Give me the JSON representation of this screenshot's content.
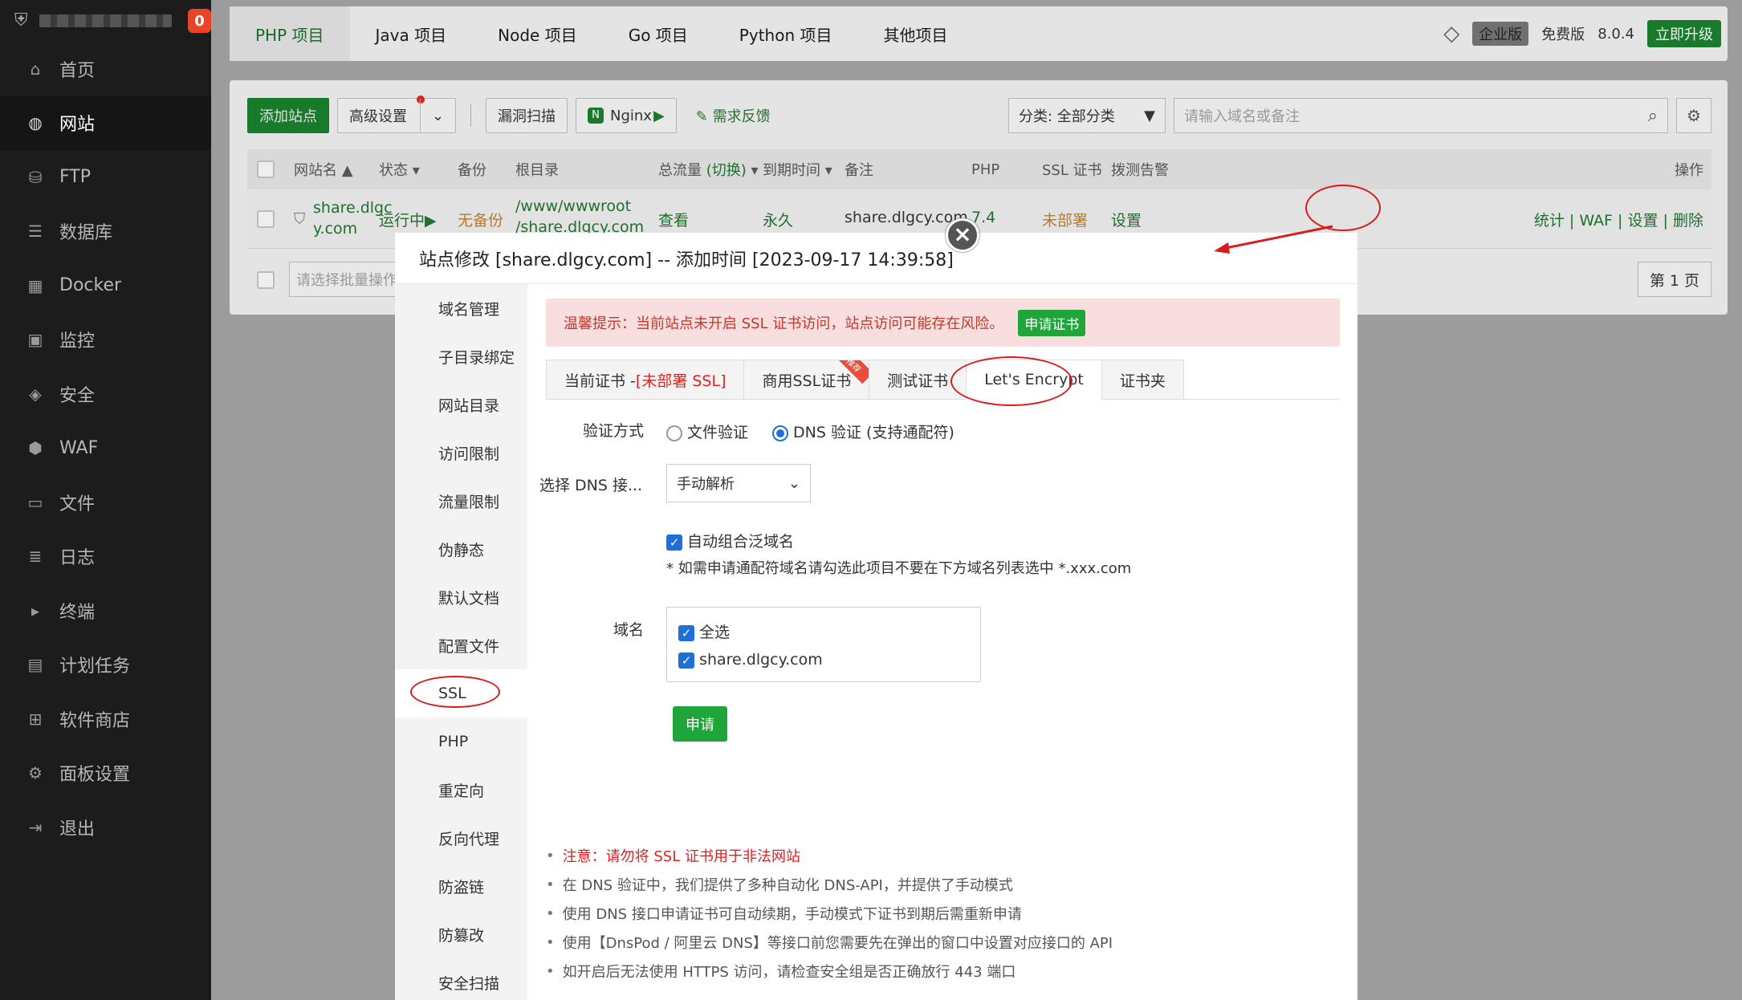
{
  "sidebar": {
    "badge": "0",
    "items": [
      {
        "label": "首页",
        "icon": "home-icon"
      },
      {
        "label": "网站",
        "icon": "globe-icon"
      },
      {
        "label": "FTP",
        "icon": "ftp-icon"
      },
      {
        "label": "数据库",
        "icon": "database-icon"
      },
      {
        "label": "Docker",
        "icon": "docker-icon"
      },
      {
        "label": "监控",
        "icon": "monitor-icon"
      },
      {
        "label": "安全",
        "icon": "shield-icon"
      },
      {
        "label": "WAF",
        "icon": "waf-icon"
      },
      {
        "label": "文件",
        "icon": "folder-icon"
      },
      {
        "label": "日志",
        "icon": "log-icon"
      },
      {
        "label": "终端",
        "icon": "terminal-icon"
      },
      {
        "label": "计划任务",
        "icon": "calendar-icon"
      },
      {
        "label": "软件商店",
        "icon": "apps-icon"
      },
      {
        "label": "面板设置",
        "icon": "settings-icon"
      },
      {
        "label": "退出",
        "icon": "logout-icon"
      }
    ]
  },
  "topbar": {
    "tabs": [
      "PHP 项目",
      "Java 项目",
      "Node 项目",
      "Go 项目",
      "Python 项目",
      "其他项目"
    ],
    "enterprise": "企业版",
    "free": "免费版",
    "version": "8.0.4",
    "upgrade": "立即升级"
  },
  "toolbar": {
    "add_site": "添加站点",
    "advanced": "高级设置",
    "vuln_scan": "漏洞扫描",
    "nginx": "Nginx",
    "feedback": "需求反馈",
    "category": "分类: 全部分类",
    "search_placeholder": "请输入域名或备注"
  },
  "table": {
    "headers": {
      "name": "网站名",
      "status": "状态",
      "backup": "备份",
      "root": "根目录",
      "traffic": "总流量",
      "switch": "(切换)",
      "expire": "到期时间",
      "remark": "备注",
      "php": "PHP",
      "ssl": "SSL 证书",
      "alert": "拨测告警",
      "ops": "操作"
    },
    "row": {
      "name_line1": "share.dlgc",
      "name_line2": "y.com",
      "status": "运行中",
      "backup": "无备份",
      "root_line1": "/www/wwwroot",
      "root_line2": "/share.dlgcy.com",
      "traffic": "查看",
      "expire": "永久",
      "remark": "share.dlgcy.com",
      "php": "7.4",
      "ssl": "未部署",
      "alert": "设置",
      "ops": [
        "统计",
        "WAF",
        "设置",
        "删除"
      ]
    },
    "batch_placeholder": "请选择批量操作",
    "page": "第 1 页"
  },
  "modal": {
    "title": "站点修改 [share.dlgcy.com] -- 添加时间 [2023-09-17 14:39:58]",
    "nav": [
      "域名管理",
      "子目录绑定",
      "网站目录",
      "访问限制",
      "流量限制",
      "伪静态",
      "默认文档",
      "配置文件",
      "SSL",
      "PHP",
      "重定向",
      "反向代理",
      "防盗链",
      "防篡改",
      "安全扫描"
    ],
    "alert_text": "温馨提示：当前站点未开启 SSL 证书访问，站点访问可能存在风险。",
    "alert_button": "申请证书",
    "tabs": {
      "current_prefix": "当前证书 - ",
      "current_status": "[未部署 SSL]",
      "commercial": "商用SSL证书",
      "ribbon": "推荐",
      "test": "测试证书",
      "letsencrypt": "Let's Encrypt",
      "folder": "证书夹"
    },
    "form": {
      "verify_label": "验证方式",
      "file_verify": "文件验证",
      "dns_verify": "DNS 验证 (支持通配符)",
      "dns_label": "选择 DNS 接...",
      "dns_value": "手动解析",
      "auto_wildcard": "自动组合泛域名",
      "wildcard_note": "* 如需申请通配符域名请勾选此项目不要在下方域名列表选中 *.xxx.com",
      "domain_label": "域名",
      "select_all": "全选",
      "domain1": "share.dlgcy.com",
      "submit": "申请"
    },
    "notes": [
      "注意：请勿将 SSL 证书用于非法网站",
      "在 DNS 验证中，我们提供了多种自动化 DNS-API，并提供了手动模式",
      "使用 DNS 接口申请证书可自动续期，手动模式下证书到期后需重新申请",
      "使用【DnsPod / 阿里云 DNS】等接口前您需要先在弹出的窗口中设置对应接口的 API",
      "如开启后无法使用 HTTPS 访问，请检查安全组是否正确放行 443 端口"
    ]
  },
  "colors": {
    "green": "#20a53a",
    "annotation_red": "#d81b1b",
    "link_blue": "#1e6fd9"
  }
}
